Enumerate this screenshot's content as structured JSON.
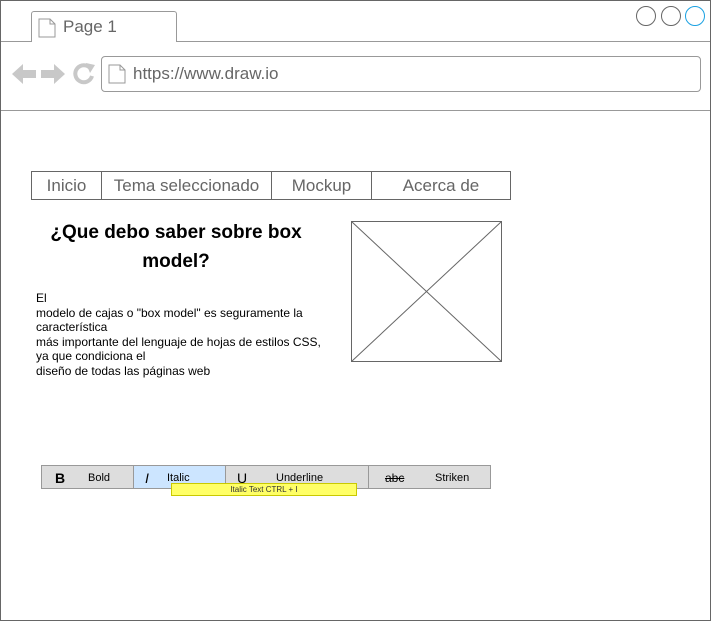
{
  "browser": {
    "tab": {
      "label": "Page 1"
    },
    "url": "https://www.draw.io",
    "colors": {
      "stroke": "#999999",
      "text": "#666666",
      "active_window_button": "#1ba1e2"
    },
    "icons": [
      "page-icon",
      "back-arrow-icon",
      "forward-arrow-icon",
      "refresh-icon"
    ]
  },
  "menu": {
    "items": [
      {
        "label": "Inicio"
      },
      {
        "label": "Tema seleccionado"
      },
      {
        "label": "Mockup"
      },
      {
        "label": "Acerca de"
      }
    ]
  },
  "content": {
    "heading": "¿Que debo saber sobre box model?",
    "body": "El\nmodelo de cajas o \"box model\" es seguramente la característica\nmás importante del lenguaje de hojas de estilos CSS, ya que condiciona el\ndiseño de todas las páginas web"
  },
  "format_toolbar": {
    "buttons": [
      {
        "glyph": "B",
        "label": "Bold"
      },
      {
        "glyph": "I",
        "label": "Italic",
        "selected": true
      },
      {
        "glyph": "U",
        "label": "Underline"
      },
      {
        "glyph": "abc",
        "label": "Striken"
      }
    ],
    "tooltip": "Italic Text CTRL + I",
    "colors": {
      "selected": "#cce5ff",
      "tooltip": "#ffff66"
    }
  }
}
